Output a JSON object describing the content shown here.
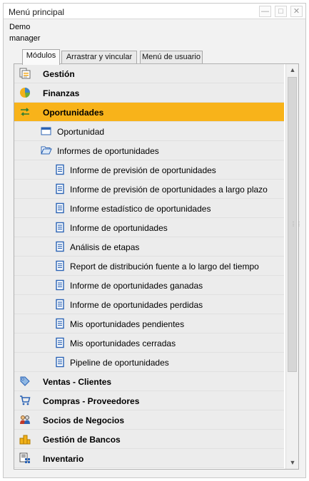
{
  "window": {
    "title": "Menú principal",
    "minimize_icon": "minimize-icon",
    "maximize_icon": "maximize-icon",
    "close_icon": "close-icon"
  },
  "user": {
    "line1": "Demo",
    "line2": "manager"
  },
  "tabs": [
    {
      "label": "Módulos",
      "active": true
    },
    {
      "label": "Arrastrar y vincular",
      "active": false
    },
    {
      "label": "Menú de usuario",
      "active": false
    }
  ],
  "menu": [
    {
      "label": "Gestión",
      "kind": "module",
      "icon": "gestion-icon"
    },
    {
      "label": "Finanzas",
      "kind": "module",
      "icon": "finanzas-pie-icon"
    },
    {
      "label": "Oportunidades",
      "kind": "module",
      "icon": "oportunidades-icon",
      "selected": true
    },
    {
      "label": "Oportunidad",
      "kind": "lvl1",
      "icon": "form-window-icon"
    },
    {
      "label": "Informes de oportunidades",
      "kind": "lvl1",
      "icon": "open-folder-icon"
    },
    {
      "label": "Informe de previsión de oportunidades",
      "kind": "lvl2",
      "icon": "report-icon"
    },
    {
      "label": "Informe de previsión de oportunidades a largo plazo",
      "kind": "lvl2",
      "icon": "report-icon"
    },
    {
      "label": "Informe estadístico de oportunidades",
      "kind": "lvl2",
      "icon": "report-icon"
    },
    {
      "label": "Informe de oportunidades",
      "kind": "lvl2",
      "icon": "report-icon"
    },
    {
      "label": "Análisis de etapas",
      "kind": "lvl2",
      "icon": "report-icon"
    },
    {
      "label": "Report de distribución fuente a lo largo del tiempo",
      "kind": "lvl2",
      "icon": "report-icon"
    },
    {
      "label": "Informe de oportunidades ganadas",
      "kind": "lvl2",
      "icon": "report-icon"
    },
    {
      "label": "Informe de oportunidades perdidas",
      "kind": "lvl2",
      "icon": "report-icon"
    },
    {
      "label": "Mis oportunidades pendientes",
      "kind": "lvl2",
      "icon": "report-icon"
    },
    {
      "label": "Mis oportunidades cerradas",
      "kind": "lvl2",
      "icon": "report-icon"
    },
    {
      "label": "Pipeline de oportunidades",
      "kind": "lvl2",
      "icon": "report-icon"
    },
    {
      "label": "Ventas - Clientes",
      "kind": "module",
      "icon": "ventas-tag-icon"
    },
    {
      "label": "Compras - Proveedores",
      "kind": "module",
      "icon": "shopping-cart-icon"
    },
    {
      "label": "Socios de Negocios",
      "kind": "module",
      "icon": "business-partners-icon"
    },
    {
      "label": "Gestión de Bancos",
      "kind": "module",
      "icon": "bank-coins-icon"
    },
    {
      "label": "Inventario",
      "kind": "module",
      "icon": "inventory-icon"
    }
  ],
  "colors": {
    "selected": "#f8b31a",
    "row": "#ececec",
    "report_icon": "#2b63b5"
  }
}
